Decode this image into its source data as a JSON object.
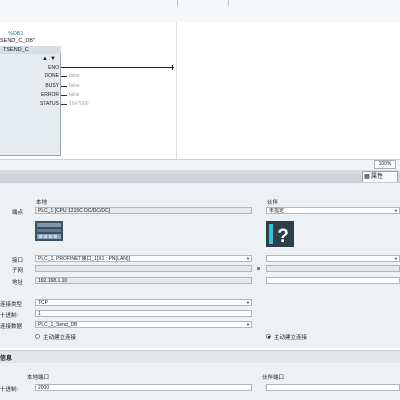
{
  "block": {
    "db_name": "%DB1",
    "instance_db": "SEND_C_DB\"",
    "fb_title": "TSEND_C",
    "pins": {
      "eno": "ENO",
      "done": "DONE",
      "busy": "BUSY",
      "error": "ERROR",
      "status": "STATUS"
    },
    "values": {
      "done": "false",
      "busy": "false",
      "error": "false",
      "status": "16#7000"
    }
  },
  "zoom": "100%",
  "inspector": {
    "properties_tab": "属性",
    "local_header": "本地",
    "partner_header": "伙伴",
    "endpoint_label": "端点",
    "local_endpoint": "PLC_1 [CPU 1215C DC/DC/DC]",
    "partner_endpoint": "未指定",
    "interface_label": "接口",
    "local_interface": "PLC_1, PROFINET接口_1[X1 : PN(LAN)]",
    "subnet_label": "子网",
    "address_label": "地址",
    "local_address": "192.168.1.10",
    "conn_type_label": "连接类型",
    "conn_type_value": "TCP",
    "conn_id_label": "十进制:",
    "conn_id_value": "1",
    "conn_data_label": "连接数据",
    "conn_data_value": "PLC_1_Send_DB",
    "active_conn_label": "主动建立连接",
    "partner_active_conn_label": "主动建立连接"
  },
  "info": {
    "section_title": "信息",
    "local_port_header": "本地端口",
    "partner_port_header": "伙伴端口",
    "decimal_label": "十进制:",
    "local_port_value": "2000"
  }
}
